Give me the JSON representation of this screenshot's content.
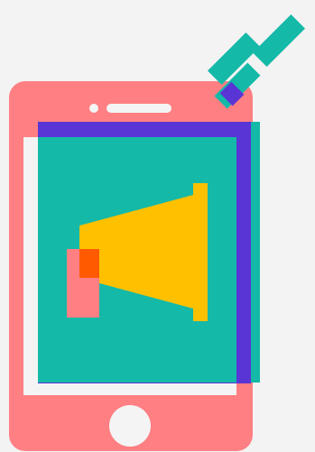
{
  "illustration": {
    "subject": "phone-with-megaphone",
    "colors": {
      "background": "#f3f3f3",
      "phone_body": "#ff7f82",
      "screen_white": "#f4f4f4",
      "screen_teal": "#14b9a8",
      "shadow_purple": "#5a35d6",
      "megaphone_yellow": "#ffc000",
      "megaphone_handle_pink": "#ff7f82",
      "megaphone_overlap_orange": "#ff5a00",
      "signal_teal": "#14b9a8",
      "home_button": "#f4f4f4"
    },
    "icons": [
      "phone-icon",
      "megaphone-icon",
      "signal-lines-icon"
    ]
  }
}
